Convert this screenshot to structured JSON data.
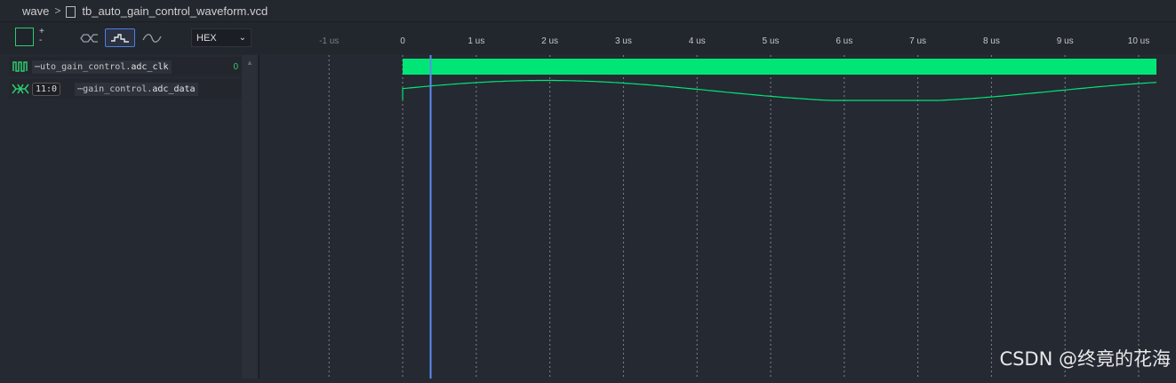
{
  "breadcrumb": {
    "root": "wave",
    "file": "tb_auto_gain_control_waveform.vcd"
  },
  "toolbar": {
    "plus": "+",
    "minus": "-",
    "radix": {
      "selected": "HEX",
      "options": [
        "HEX"
      ]
    },
    "modes": [
      "digital-mode-icon",
      "step-analog-mode-icon",
      "smooth-analog-mode-icon"
    ],
    "active_mode": "step-analog-mode-icon"
  },
  "ruler": {
    "unit": "us",
    "ticks": [
      "-1 us",
      "0",
      "1 us",
      "2 us",
      "3 us",
      "4 us",
      "5 us",
      "6 us",
      "7 us",
      "8 us",
      "9 us",
      "10 us"
    ]
  },
  "signals": [
    {
      "prefix": "⋯uto_gain_control.",
      "name": "adc_clk",
      "value": "0",
      "icon": "clock-signal-icon"
    },
    {
      "prefix": "⋯gain_control.",
      "name": "adc_data",
      "width": "11:0",
      "icon": "bus-signal-icon"
    }
  ],
  "cursor": {
    "time_us": 0.38
  },
  "colors": {
    "signal": "#00e676",
    "cursor": "#5b8dee",
    "accent": "#2ecc71"
  },
  "watermark": "CSDN @终竟的花海"
}
